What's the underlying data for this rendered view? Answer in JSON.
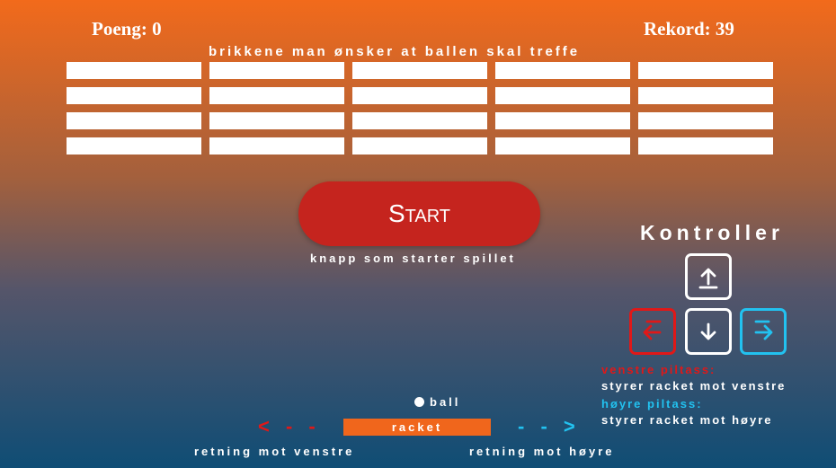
{
  "score": {
    "label": "Poeng: 0"
  },
  "record": {
    "label": "Rekord: 39"
  },
  "bricks": {
    "caption": "brikkene man ønsker at ballen skal treffe",
    "rows": 4,
    "columns": 5
  },
  "start": {
    "label": "Start",
    "caption": "knapp som starter spillet"
  },
  "controls": {
    "title": "Kontroller",
    "keys": [
      {
        "icon": "arrow-up-icon"
      },
      {
        "icon": "arrow-left-icon",
        "color": "#e01818"
      },
      {
        "icon": "arrow-down-icon"
      },
      {
        "icon": "arrow-right-icon",
        "color": "#22c2f0"
      }
    ],
    "left_key_label": "venstre piltass:",
    "left_key_desc": "styrer racket mot venstre",
    "right_key_label": "høyre piltass:",
    "right_key_desc": "styrer racket mot høyre"
  },
  "game": {
    "ball_label": "ball",
    "racket_label": "racket",
    "left_arrow": "< - -",
    "right_arrow": "- - >",
    "left_caption": "retning mot venstre",
    "right_caption": "retning mot høyre"
  },
  "colors": {
    "accent_red": "#e01818",
    "accent_blue": "#22c2f0",
    "button": "#c5241e",
    "racket": "#f0661c"
  }
}
